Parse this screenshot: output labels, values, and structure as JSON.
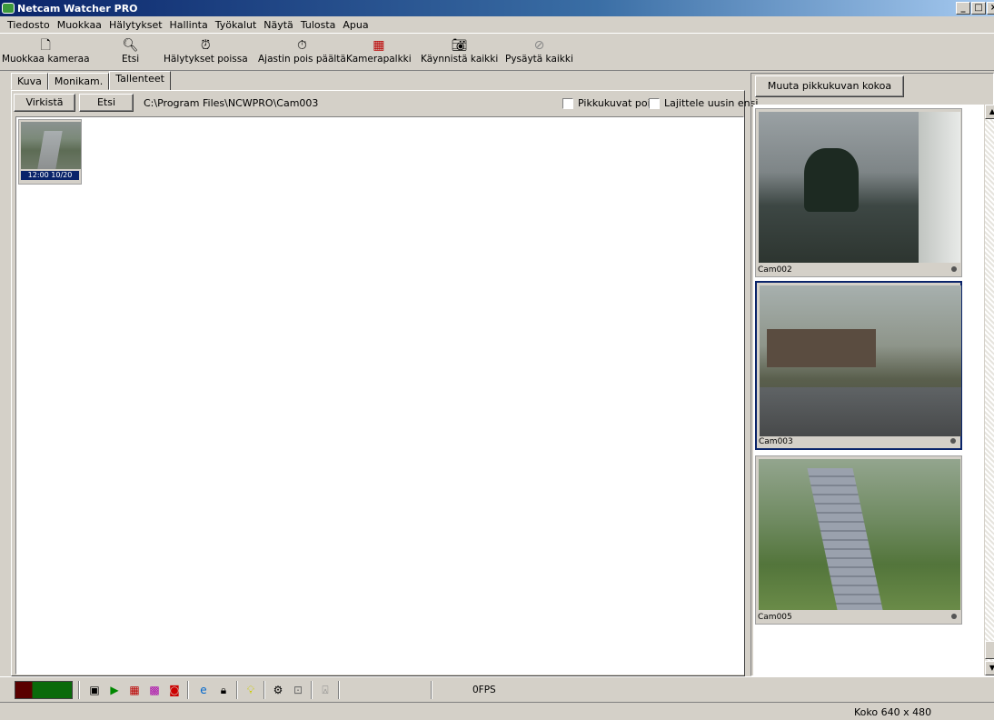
{
  "window": {
    "title": "Netcam Watcher PRO"
  },
  "menu": [
    "Tiedosto",
    "Muokkaa",
    "Hälytykset",
    "Hallinta",
    "Työkalut",
    "Näytä",
    "Tulosta",
    "Apua"
  ],
  "toolbar": {
    "edit_camera": "Muokkaa kameraa",
    "search": "Etsi",
    "alarms_off": "Hälytykset poissa",
    "timer_off": "Ajastin pois päältä",
    "camera_bar": "Kamerapalkki",
    "start_all": "Käynnistä kaikki",
    "stop_all": "Pysäytä kaikki"
  },
  "tabs": [
    "Kuva",
    "Monikam.",
    "Tallenteet"
  ],
  "recordings": {
    "refresh_button": "Virkistä",
    "search_button": "Etsi",
    "path": "C:\\Program Files\\NCWPRO\\Cam003",
    "thumbnails_off": "Pikkukuvat pois",
    "sort_newest": "Lajittele uusin ensi",
    "items": [
      {
        "caption": "12:00  10/20"
      }
    ]
  },
  "right_panel": {
    "resize_button": "Muuta pikkukuvan kokoa",
    "cameras": [
      {
        "name": "Cam002"
      },
      {
        "name": "Cam003"
      },
      {
        "name": "Cam005"
      }
    ]
  },
  "statusbar": {
    "fps": "0FPS",
    "size": "Koko 640 x 480"
  }
}
